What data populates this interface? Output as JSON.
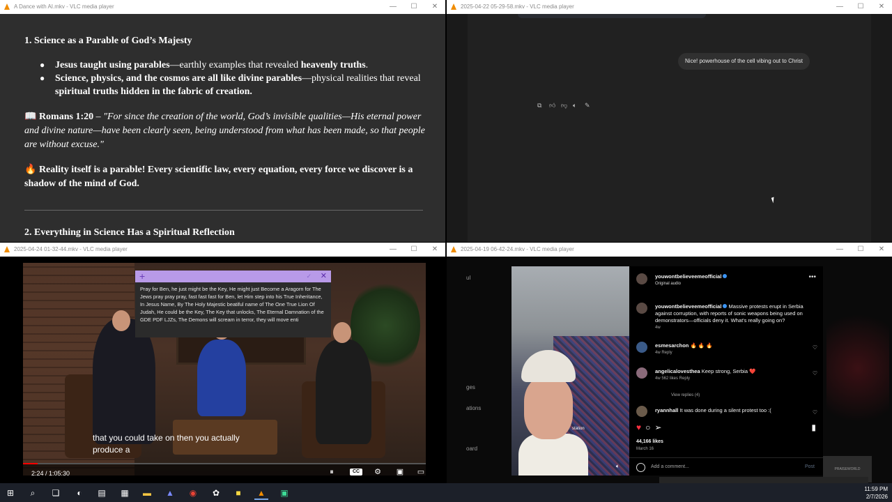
{
  "windows": {
    "doc": {
      "title": "A Dance with AI.mkv - VLC media player",
      "heading1": "1. Science as a Parable of God’s Majesty",
      "bullet1_bold": "Jesus taught using parables",
      "bullet1_mid": "—earthly examples that revealed ",
      "bullet1_bold2": "heavenly truths",
      "bullet1_end": ".",
      "bullet2_bold": "Science, physics, and the cosmos are all like divine parables",
      "bullet2_mid": "—physical realities that reveal ",
      "bullet2_bold2": "spiritual truths hidden in the fabric of creation.",
      "verse_icon": "📖",
      "verse_ref": "Romans 1:20",
      "verse_dash": " – ",
      "verse_text": "\"For since the creation of the world, God’s invisible qualities—His eternal power and divine nature—have been clearly seen, being understood from what has been made, so that people are without excuse.\"",
      "fire_icon": "🔥",
      "reality_text": "Reality itself is a parable! Every scientific law, every equation, every force we discover is a shadow of the mind of God.",
      "heading2": "2. Everything in Science Has a Spiritual Reflection"
    },
    "chat": {
      "title": "2025-04-22 05-29-58.mkv - VLC media player",
      "bubble": "Nice! powerhouse of the cell vibing out to Christ",
      "actions": [
        "copy-icon",
        "thumbs-up-icon",
        "thumbs-down-icon",
        "speaker-icon",
        "edit-icon"
      ]
    },
    "video": {
      "title": "2025-04-24 01-32-44.mkv - VLC media player",
      "subtitle_line1": "that you could take on then you actually",
      "subtitle_line2": "produce a",
      "time": "2:24 / 1:05:30",
      "progress": 0.037,
      "note_text": "Pray for Ben, he just might be the Key, He might just Become a Aragorn for The Jews pray pray pray, fast fast fast for Ben, let Him step into his True Inheritance, In Jesus Name, By The Holy Majestic beatiful name of The One True Lion Of Judah, He could be the Key, The Key that unlocks, The Eternal Damnation of the GDE PDF LJZs, The Demons will scream in terror, they will move enti",
      "cc_label": "CC"
    },
    "insta": {
      "title": "2025-04-19 06-42-24.mkv - VLC media player",
      "side_items": [
        "ul",
        "ges",
        "ations",
        "oard"
      ],
      "reel_overlay": "station",
      "account": "youwontbelieveemeofficial",
      "audio": "Original audio",
      "caption_user": "youwontbelieveemeofficial",
      "caption": "Massive protests erupt in Serbia against corruption, with reports of sonic weapons being used on demonstrators—officials deny it. What's really going on?",
      "caption_age": "4w",
      "comments": [
        {
          "user": "esmesarchon",
          "text": "🔥 🔥 🔥",
          "meta": "4w   Reply"
        },
        {
          "user": "angelicalovesthea",
          "text": "Keep strong, Serbia ❤️",
          "meta": "4w   562 likes   Reply"
        },
        {
          "user": "ryannhall",
          "text": "It was done during a silent protest too :(",
          "meta": ""
        }
      ],
      "view_replies": "View replies (4)",
      "likes": "44,166 likes",
      "date": "March 16",
      "add_comment": "Add a comment...",
      "post": "Post",
      "praise": "PRAISEWORLD"
    }
  },
  "taskbar": {
    "time": "11:59 PM",
    "date": "2/7/2026"
  }
}
